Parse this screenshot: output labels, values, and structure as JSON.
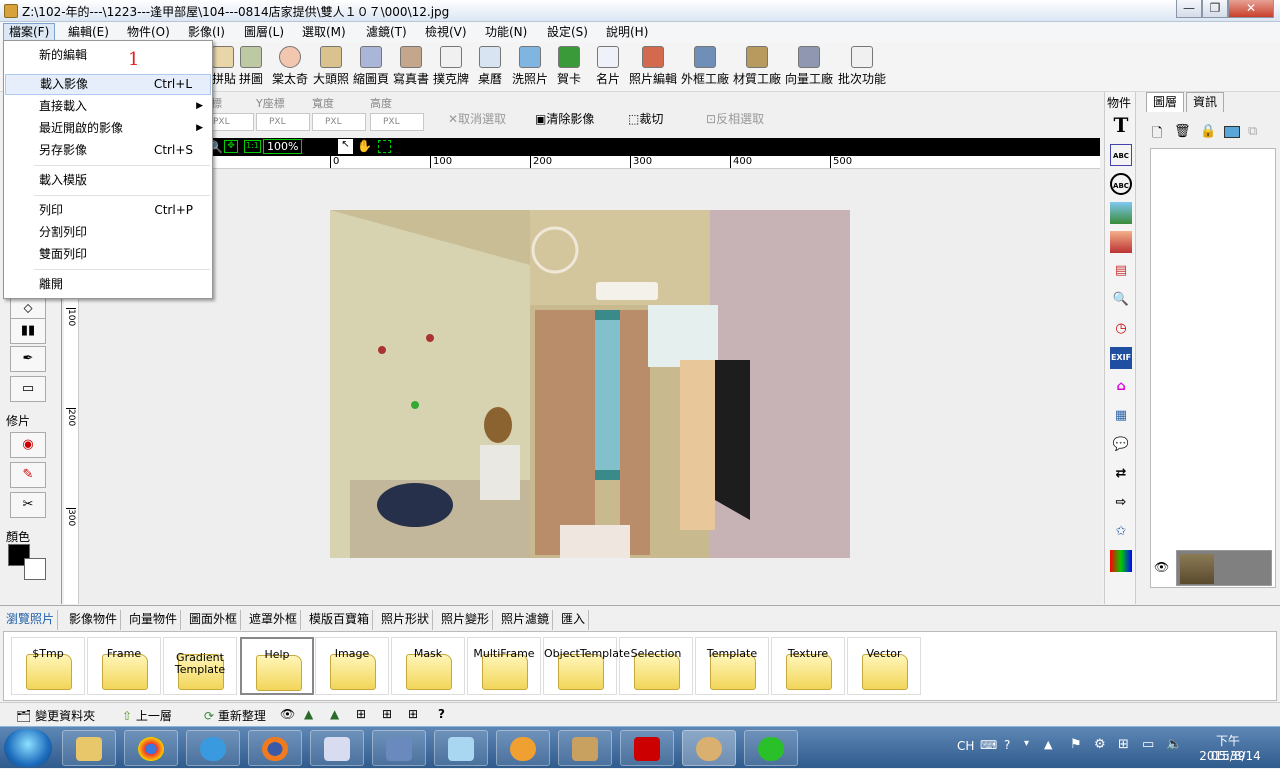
{
  "window": {
    "title": "Z:\\102-年的---\\1223---逢甲部屋\\104---0814店家提供\\雙人１０７\\000\\12.jpg",
    "buttons": {
      "min": "—",
      "max": "❐",
      "close": "✕"
    }
  },
  "menubar": [
    "檔案(F)",
    "編輯(E)",
    "物件(O)",
    "影像(I)",
    "圖層(L)",
    "選取(M)",
    "濾鏡(T)",
    "檢視(V)",
    "功能(N)",
    "設定(S)",
    "說明(H)"
  ],
  "file_menu": {
    "items": [
      {
        "label": "新的編輯",
        "shortcut": "",
        "submenu": false
      },
      {
        "label": "載入影像",
        "shortcut": "Ctrl+L",
        "submenu": false
      },
      {
        "label": "直接載入",
        "shortcut": "",
        "submenu": true
      },
      {
        "label": "最近開啟的影像",
        "shortcut": "",
        "submenu": true
      },
      {
        "label": "另存影像",
        "shortcut": "Ctrl+S",
        "submenu": false
      },
      {
        "label": "載入模版",
        "shortcut": "",
        "submenu": false
      },
      {
        "label": "列印",
        "shortcut": "Ctrl+P",
        "submenu": false
      },
      {
        "label": "分割列印",
        "shortcut": "",
        "submenu": false
      },
      {
        "label": "雙面列印",
        "shortcut": "",
        "submenu": false
      },
      {
        "label": "離開",
        "shortcut": "",
        "submenu": false
      }
    ],
    "annotation": "1"
  },
  "toolbar": [
    "拼貼",
    "拼圖",
    "棠太奇",
    "大頭照",
    "縮圖頁",
    "寫真書",
    "撲克牌",
    "桌曆",
    "洗照片",
    "賀卡",
    "名片",
    "照片編輯",
    "外框工廠",
    "材質工廠",
    "向量工廠",
    "批次功能"
  ],
  "options": {
    "fields": [
      {
        "label": "座標",
        "unit": "PXL"
      },
      {
        "label": "Y座標",
        "unit": "PXL"
      },
      {
        "label": "寬度",
        "unit": "PXL"
      },
      {
        "label": "高度",
        "unit": "PXL"
      }
    ],
    "buttons": [
      "取消選取",
      "清除影像",
      "裁切",
      "反相選取"
    ]
  },
  "viewbar": {
    "zoom": "100%",
    "fit": "1:1"
  },
  "hruler": [
    "0",
    "100",
    "200",
    "300",
    "400",
    "500"
  ],
  "vruler": [
    "100",
    "200",
    "300"
  ],
  "left_panel": {
    "section_retouch": "修片",
    "section_color": "顏色"
  },
  "object_panel": {
    "title": "物件",
    "text_tool": "T",
    "abc_tool": "ABC",
    "exif_tool": "EXIF"
  },
  "right_panel": {
    "tabs": [
      "圖層",
      "資訊"
    ]
  },
  "browser_tabs": [
    "瀏覽照片",
    "影像物件",
    "向量物件",
    "圖面外框",
    "遮罩外框",
    "模版百寶箱",
    "照片形狀",
    "照片變形",
    "照片濾鏡",
    "匯入"
  ],
  "folders": [
    "$Tmp",
    "Frame",
    "Gradient Template",
    "Help",
    "Image",
    "Mask",
    "MultiFrame",
    "ObjectTemplate",
    "Selection",
    "Template",
    "Texture",
    "Vector"
  ],
  "bottombar": [
    "變更資料夾",
    "上一層",
    "重新整理",
    "?"
  ],
  "taskbar": {
    "ime": "CH",
    "time": "下午 05:39",
    "date": "2015/8/14"
  },
  "colors": {
    "accent": "#1f5fa8",
    "highlight": "#e5eefa",
    "annotation": "#e02020"
  }
}
